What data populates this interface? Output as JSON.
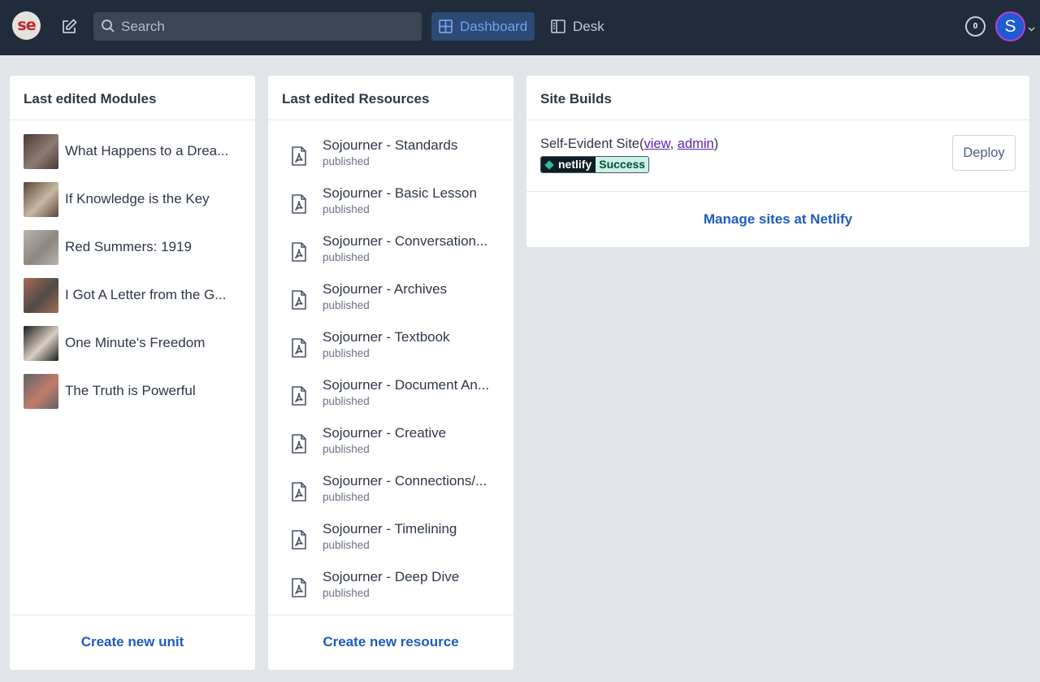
{
  "topbar": {
    "logo_text": "se",
    "search_placeholder": "Search",
    "nav": {
      "dashboard": "Dashboard",
      "desk": "Desk"
    },
    "notification_count": "0",
    "user_initial": "S",
    "icons": [
      "edit-icon",
      "search-icon",
      "dashboard-icon",
      "desk-icon",
      "chevron-down-icon"
    ]
  },
  "modules": {
    "title": "Last edited Modules",
    "items": [
      {
        "title": "What Happens to a Drea...",
        "thumb": [
          "#4a3a34",
          "#8c7c72"
        ]
      },
      {
        "title": "If Knowledge is the Key",
        "thumb": [
          "#5a4638",
          "#c9b8a6"
        ]
      },
      {
        "title": "Red Summers: 1919",
        "thumb": [
          "#b8b3ad",
          "#8d8780"
        ]
      },
      {
        "title": "I Got A Letter from the G...",
        "thumb": [
          "#a86c56",
          "#4f4a45"
        ]
      },
      {
        "title": "One Minute's Freedom",
        "thumb": [
          "#1d1d1d",
          "#d9cfc2"
        ]
      },
      {
        "title": "The Truth is Powerful",
        "thumb": [
          "#5f6468",
          "#c27b6a"
        ]
      }
    ],
    "create_label": "Create new unit"
  },
  "resources": {
    "title": "Last edited Resources",
    "items": [
      {
        "title": "Sojourner - Standards",
        "status": "published"
      },
      {
        "title": "Sojourner - Basic Lesson",
        "status": "published"
      },
      {
        "title": "Sojourner - Conversation...",
        "status": "published"
      },
      {
        "title": "Sojourner - Archives",
        "status": "published"
      },
      {
        "title": "Sojourner - Textbook",
        "status": "published"
      },
      {
        "title": "Sojourner - Document An...",
        "status": "published"
      },
      {
        "title": "Sojourner - Creative",
        "status": "published"
      },
      {
        "title": "Sojourner - Connections/...",
        "status": "published"
      },
      {
        "title": "Sojourner - Timelining",
        "status": "published"
      },
      {
        "title": "Sojourner - Deep Dive",
        "status": "published"
      }
    ],
    "create_label": "Create new resource"
  },
  "builds": {
    "title": "Site Builds",
    "site_name": "Self-Evident Site",
    "view_label": "view",
    "admin_label": "admin",
    "badge_left": "netlify",
    "badge_right": "Success",
    "deploy_label": "Deploy",
    "manage_label": "Manage sites at Netlify"
  },
  "colors": {
    "topbar_bg": "#202b3b",
    "accent": "#1f5bbf",
    "page_bg": "#e1e4e9"
  }
}
